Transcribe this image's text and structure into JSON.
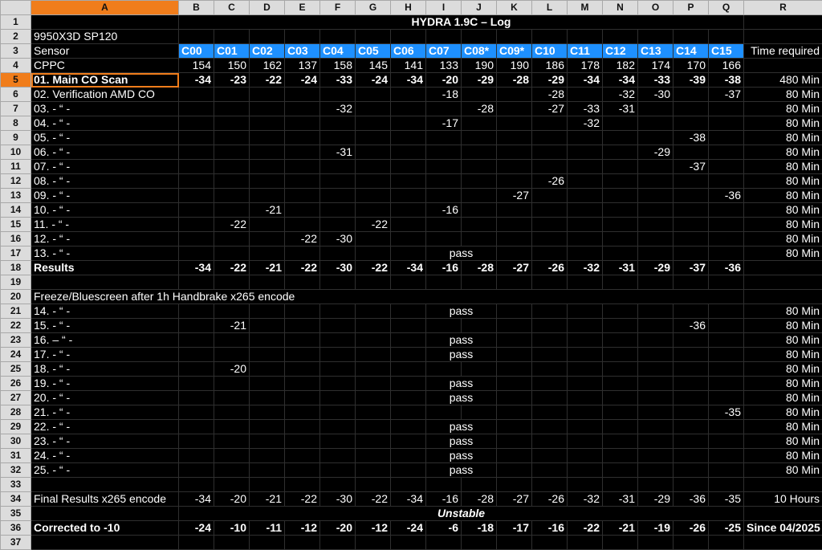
{
  "columns": [
    "A",
    "B",
    "C",
    "D",
    "E",
    "F",
    "G",
    "H",
    "I",
    "J",
    "K",
    "L",
    "M",
    "N",
    "O",
    "P",
    "Q",
    "R"
  ],
  "selected_column": "A",
  "selected_row": 5,
  "title": "HYDRA 1.9C – Log",
  "cpu_model": "9950X3D SP120",
  "header_row": {
    "label": "Sensor",
    "cores": [
      "C00",
      "C01",
      "C02",
      "C03",
      "C04",
      "C05",
      "C06",
      "C07",
      "C08*",
      "C09*",
      "C10",
      "C11",
      "C12",
      "C13",
      "C14",
      "C15"
    ],
    "time_label": "Time required"
  },
  "cppc": {
    "label": "CPPC",
    "values": [
      "154",
      "150",
      "162",
      "137",
      "158",
      "145",
      "141",
      "133",
      "190",
      "190",
      "186",
      "178",
      "182",
      "174",
      "170",
      "166"
    ]
  },
  "rows": [
    {
      "row": 5,
      "label": "01. Main CO Scan",
      "style": "main",
      "values": [
        "-34",
        "-23",
        "-22",
        "-24",
        "-33",
        "-24",
        "-34",
        "-20",
        "-29",
        "-28",
        "-29",
        "-34",
        "-34",
        "-33",
        "-39",
        "-38"
      ],
      "time": "480 Min"
    },
    {
      "row": 6,
      "label": "02. Verification AMD CO",
      "values": [
        "",
        "",
        "",
        "",
        "",
        "",
        "",
        "-18",
        "",
        "",
        "-28",
        "",
        "-32",
        "-30",
        "",
        "-37"
      ],
      "time": "80 Min"
    },
    {
      "row": 7,
      "label": "03. - “ -",
      "values": [
        "",
        "",
        "",
        "",
        "-32",
        "",
        "",
        "",
        "-28",
        "",
        "-27",
        "-33",
        "-31",
        "",
        "",
        ""
      ],
      "time": "80 Min"
    },
    {
      "row": 8,
      "label": "04. - “ -",
      "values": [
        "",
        "",
        "",
        "",
        "",
        "",
        "",
        "-17",
        "",
        "",
        "",
        "-32",
        "",
        "",
        "",
        ""
      ],
      "time": "80 Min"
    },
    {
      "row": 9,
      "label": "05. - “ -",
      "values": [
        "",
        "",
        "",
        "",
        "",
        "",
        "",
        "",
        "",
        "",
        "",
        "",
        "",
        "",
        "-38",
        ""
      ],
      "time": "80 Min"
    },
    {
      "row": 10,
      "label": "06. - “ -",
      "values": [
        "",
        "",
        "",
        "",
        "-31",
        "",
        "",
        "",
        "",
        "",
        "",
        "",
        "",
        "-29",
        "",
        ""
      ],
      "time": "80 Min"
    },
    {
      "row": 11,
      "label": "07. - “ -",
      "values": [
        "",
        "",
        "",
        "",
        "",
        "",
        "",
        "",
        "",
        "",
        "",
        "",
        "",
        "",
        "-37",
        ""
      ],
      "time": "80 Min"
    },
    {
      "row": 12,
      "label": "08. - “ -",
      "values": [
        "",
        "",
        "",
        "",
        "",
        "",
        "",
        "",
        "",
        "",
        "-26",
        "",
        "",
        "",
        "",
        ""
      ],
      "time": "80 Min"
    },
    {
      "row": 13,
      "label": "09. - “ -",
      "values": [
        "",
        "",
        "",
        "",
        "",
        "",
        "",
        "",
        "",
        "-27",
        "",
        "",
        "",
        "",
        "",
        "-36"
      ],
      "time": "80 Min"
    },
    {
      "row": 14,
      "label": "10. - “ -",
      "values": [
        "",
        "",
        "-21",
        "",
        "",
        "",
        "",
        "-16",
        "",
        "",
        "",
        "",
        "",
        "",
        "",
        ""
      ],
      "time": "80 Min"
    },
    {
      "row": 15,
      "label": "11. - “ -",
      "values": [
        "",
        "-22",
        "",
        "",
        "",
        "-22",
        "",
        "",
        "",
        "",
        "",
        "",
        "",
        "",
        "",
        ""
      ],
      "time": "80 Min"
    },
    {
      "row": 16,
      "label": "12. - “ -",
      "values": [
        "",
        "",
        "",
        "-22",
        "-30",
        "",
        "",
        "",
        "",
        "",
        "",
        "",
        "",
        "",
        "",
        ""
      ],
      "time": "80 Min"
    },
    {
      "row": 17,
      "label": "13. - “ -",
      "pass": "pass",
      "time": "80 Min"
    },
    {
      "row": 18,
      "label": "Results",
      "style": "result",
      "values": [
        "-34",
        "-22",
        "-21",
        "-22",
        "-30",
        "-22",
        "-34",
        "-16",
        "-28",
        "-27",
        "-26",
        "-32",
        "-31",
        "-29",
        "-37",
        "-36"
      ],
      "time": ""
    },
    {
      "row": 19,
      "blank": true
    },
    {
      "row": 20,
      "note": "Freeze/Bluescreen after 1h Handbrake x265 encode"
    },
    {
      "row": 21,
      "label": "14. - “ -",
      "pass": "pass",
      "time": "80 Min"
    },
    {
      "row": 22,
      "label": "15. - “ -",
      "values": [
        "",
        "-21",
        "",
        "",
        "",
        "",
        "",
        "",
        "",
        "",
        "",
        "",
        "",
        "",
        "-36",
        ""
      ],
      "time": "80 Min"
    },
    {
      "row": 23,
      "label": "16. – “ -",
      "pass": "pass",
      "time": "80 Min"
    },
    {
      "row": 24,
      "label": "17. - “ -",
      "pass": "pass",
      "time": "80 Min"
    },
    {
      "row": 25,
      "label": "18. - “ -",
      "values": [
        "",
        "-20",
        "",
        "",
        "",
        "",
        "",
        "",
        "",
        "",
        "",
        "",
        "",
        "",
        "",
        ""
      ],
      "time": "80 Min"
    },
    {
      "row": 26,
      "label": "19. - “ -",
      "pass": "pass",
      "time": "80 Min"
    },
    {
      "row": 27,
      "label": "20. - “ -",
      "pass": "pass",
      "time": "80 Min"
    },
    {
      "row": 28,
      "label": "21. - “ -",
      "values": [
        "",
        "",
        "",
        "",
        "",
        "",
        "",
        "",
        "",
        "",
        "",
        "",
        "",
        "",
        "",
        "-35"
      ],
      "time": "80 Min"
    },
    {
      "row": 29,
      "label": "22. - “ -",
      "pass": "pass",
      "time": "80 Min"
    },
    {
      "row": 30,
      "label": "23. - “ -",
      "pass": "pass",
      "time": "80 Min"
    },
    {
      "row": 31,
      "label": "24. - “ -",
      "pass": "pass",
      "time": "80 Min"
    },
    {
      "row": 32,
      "label": "25. - “ -",
      "pass": "pass",
      "time": "80 Min"
    },
    {
      "row": 33,
      "blank": true
    },
    {
      "row": 34,
      "label": "Final Results x265 encode",
      "style": "final",
      "values": [
        "-34",
        "-20",
        "-21",
        "-22",
        "-30",
        "-22",
        "-34",
        "-16",
        "-28",
        "-27",
        "-26",
        "-32",
        "-31",
        "-29",
        "-36",
        "-35"
      ],
      "time": "10 Hours"
    },
    {
      "row": 35,
      "unstable": "Unstable"
    },
    {
      "row": 36,
      "label": "Corrected to -10",
      "style": "corr",
      "values": [
        "-24",
        "-10",
        "-11",
        "-12",
        "-20",
        "-12",
        "-24",
        "-6",
        "-18",
        "-17",
        "-16",
        "-22",
        "-21",
        "-19",
        "-26",
        "-25"
      ],
      "time": "Since 04/2025"
    },
    {
      "row": 37,
      "blank": true
    }
  ]
}
